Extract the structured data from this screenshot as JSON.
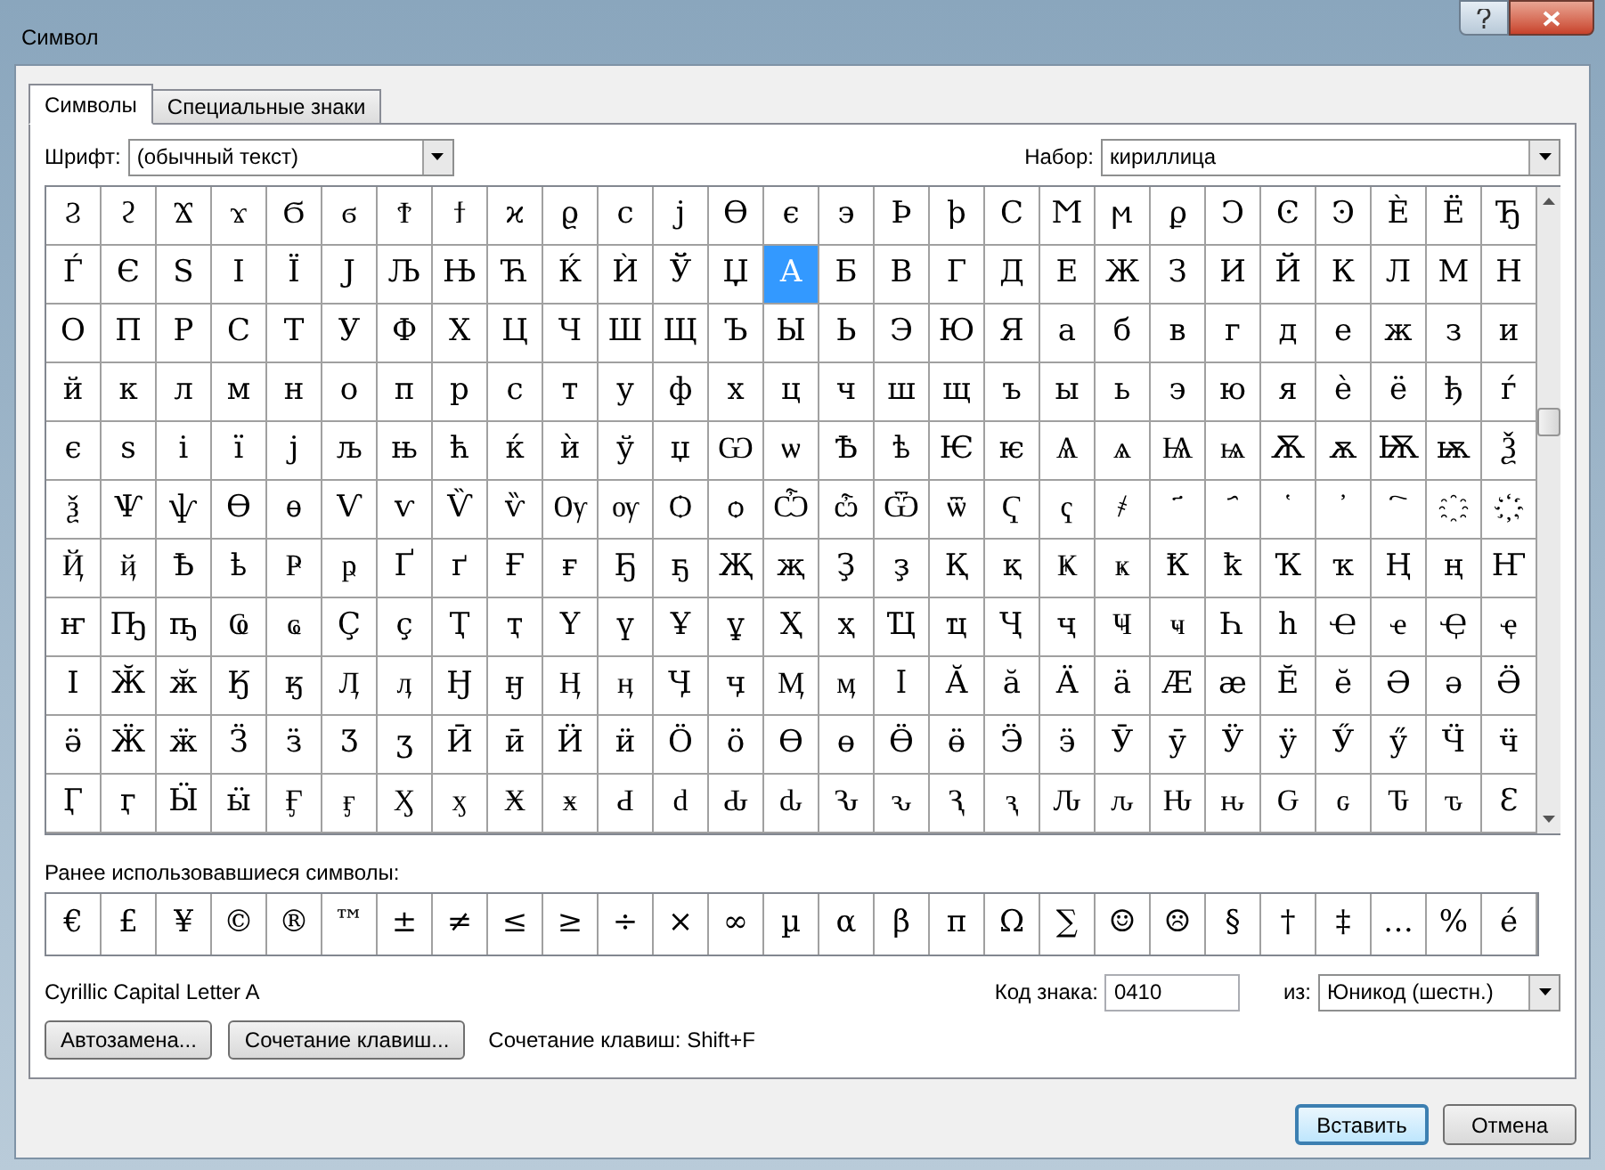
{
  "window": {
    "title": "Символ"
  },
  "tabs": [
    {
      "label": "Символы",
      "selected": true
    },
    {
      "label": "Специальные знаки",
      "selected": false
    }
  ],
  "font": {
    "label": "Шрифт:",
    "value": "(обычный текст)"
  },
  "subset": {
    "label": "Набор:",
    "value": "кириллица"
  },
  "symbol_grid": [
    [
      {
        "ch": "Ϩ",
        "selected": false
      },
      {
        "ch": "ϩ",
        "selected": false
      },
      {
        "ch": "Ϫ",
        "selected": false
      },
      {
        "ch": "ϫ",
        "selected": false
      },
      {
        "ch": "Ϭ",
        "selected": false
      },
      {
        "ch": "ϭ",
        "selected": false
      },
      {
        "ch": "Ϯ",
        "selected": false
      },
      {
        "ch": "ϯ",
        "selected": false
      },
      {
        "ch": "ϰ",
        "selected": false
      },
      {
        "ch": "ϱ",
        "selected": false
      },
      {
        "ch": "ϲ",
        "selected": false
      },
      {
        "ch": "ϳ",
        "selected": false
      },
      {
        "ch": "ϴ",
        "selected": false
      },
      {
        "ch": "ϵ",
        "selected": false
      },
      {
        "ch": "϶",
        "selected": false
      },
      {
        "ch": "Ϸ",
        "selected": false
      },
      {
        "ch": "ϸ",
        "selected": false
      },
      {
        "ch": "Ϲ",
        "selected": false
      },
      {
        "ch": "Ϻ",
        "selected": false
      },
      {
        "ch": "ϻ",
        "selected": false
      },
      {
        "ch": "ϼ",
        "selected": false
      },
      {
        "ch": "Ͻ",
        "selected": false
      },
      {
        "ch": "Ͼ",
        "selected": false
      },
      {
        "ch": "Ͽ",
        "selected": false
      },
      {
        "ch": "Ѐ",
        "selected": false
      },
      {
        "ch": "Ё",
        "selected": false
      },
      {
        "ch": "Ђ",
        "selected": false
      }
    ],
    [
      {
        "ch": "Ѓ",
        "selected": false
      },
      {
        "ch": "Є",
        "selected": false
      },
      {
        "ch": "Ѕ",
        "selected": false
      },
      {
        "ch": "І",
        "selected": false
      },
      {
        "ch": "Ї",
        "selected": false
      },
      {
        "ch": "Ј",
        "selected": false
      },
      {
        "ch": "Љ",
        "selected": false
      },
      {
        "ch": "Њ",
        "selected": false
      },
      {
        "ch": "Ћ",
        "selected": false
      },
      {
        "ch": "Ќ",
        "selected": false
      },
      {
        "ch": "Ѝ",
        "selected": false
      },
      {
        "ch": "Ў",
        "selected": false
      },
      {
        "ch": "Џ",
        "selected": false
      },
      {
        "ch": "А",
        "selected": true
      },
      {
        "ch": "Б",
        "selected": false
      },
      {
        "ch": "В",
        "selected": false
      },
      {
        "ch": "Г",
        "selected": false
      },
      {
        "ch": "Д",
        "selected": false
      },
      {
        "ch": "Е",
        "selected": false
      },
      {
        "ch": "Ж",
        "selected": false
      },
      {
        "ch": "З",
        "selected": false
      },
      {
        "ch": "И",
        "selected": false
      },
      {
        "ch": "Й",
        "selected": false
      },
      {
        "ch": "К",
        "selected": false
      },
      {
        "ch": "Л",
        "selected": false
      },
      {
        "ch": "М",
        "selected": false
      },
      {
        "ch": "Н",
        "selected": false
      }
    ],
    [
      {
        "ch": "О",
        "selected": false
      },
      {
        "ch": "П",
        "selected": false
      },
      {
        "ch": "Р",
        "selected": false
      },
      {
        "ch": "С",
        "selected": false
      },
      {
        "ch": "Т",
        "selected": false
      },
      {
        "ch": "У",
        "selected": false
      },
      {
        "ch": "Ф",
        "selected": false
      },
      {
        "ch": "Х",
        "selected": false
      },
      {
        "ch": "Ц",
        "selected": false
      },
      {
        "ch": "Ч",
        "selected": false
      },
      {
        "ch": "Ш",
        "selected": false
      },
      {
        "ch": "Щ",
        "selected": false
      },
      {
        "ch": "Ъ",
        "selected": false
      },
      {
        "ch": "Ы",
        "selected": false
      },
      {
        "ch": "Ь",
        "selected": false
      },
      {
        "ch": "Э",
        "selected": false
      },
      {
        "ch": "Ю",
        "selected": false
      },
      {
        "ch": "Я",
        "selected": false
      },
      {
        "ch": "а",
        "selected": false
      },
      {
        "ch": "б",
        "selected": false
      },
      {
        "ch": "в",
        "selected": false
      },
      {
        "ch": "г",
        "selected": false
      },
      {
        "ch": "д",
        "selected": false
      },
      {
        "ch": "е",
        "selected": false
      },
      {
        "ch": "ж",
        "selected": false
      },
      {
        "ch": "з",
        "selected": false
      },
      {
        "ch": "и",
        "selected": false
      }
    ],
    [
      {
        "ch": "й",
        "selected": false
      },
      {
        "ch": "к",
        "selected": false
      },
      {
        "ch": "л",
        "selected": false
      },
      {
        "ch": "м",
        "selected": false
      },
      {
        "ch": "н",
        "selected": false
      },
      {
        "ch": "о",
        "selected": false
      },
      {
        "ch": "п",
        "selected": false
      },
      {
        "ch": "р",
        "selected": false
      },
      {
        "ch": "с",
        "selected": false
      },
      {
        "ch": "т",
        "selected": false
      },
      {
        "ch": "у",
        "selected": false
      },
      {
        "ch": "ф",
        "selected": false
      },
      {
        "ch": "х",
        "selected": false
      },
      {
        "ch": "ц",
        "selected": false
      },
      {
        "ch": "ч",
        "selected": false
      },
      {
        "ch": "ш",
        "selected": false
      },
      {
        "ch": "щ",
        "selected": false
      },
      {
        "ch": "ъ",
        "selected": false
      },
      {
        "ch": "ы",
        "selected": false
      },
      {
        "ch": "ь",
        "selected": false
      },
      {
        "ch": "э",
        "selected": false
      },
      {
        "ch": "ю",
        "selected": false
      },
      {
        "ch": "я",
        "selected": false
      },
      {
        "ch": "ѐ",
        "selected": false
      },
      {
        "ch": "ё",
        "selected": false
      },
      {
        "ch": "ђ",
        "selected": false
      },
      {
        "ch": "ѓ",
        "selected": false
      }
    ],
    [
      {
        "ch": "є",
        "selected": false
      },
      {
        "ch": "ѕ",
        "selected": false
      },
      {
        "ch": "і",
        "selected": false
      },
      {
        "ch": "ї",
        "selected": false
      },
      {
        "ch": "ј",
        "selected": false
      },
      {
        "ch": "љ",
        "selected": false
      },
      {
        "ch": "њ",
        "selected": false
      },
      {
        "ch": "ћ",
        "selected": false
      },
      {
        "ch": "ќ",
        "selected": false
      },
      {
        "ch": "ѝ",
        "selected": false
      },
      {
        "ch": "ў",
        "selected": false
      },
      {
        "ch": "џ",
        "selected": false
      },
      {
        "ch": "Ѡ",
        "selected": false
      },
      {
        "ch": "ѡ",
        "selected": false
      },
      {
        "ch": "Ѣ",
        "selected": false
      },
      {
        "ch": "ѣ",
        "selected": false
      },
      {
        "ch": "Ѥ",
        "selected": false
      },
      {
        "ch": "ѥ",
        "selected": false
      },
      {
        "ch": "Ѧ",
        "selected": false
      },
      {
        "ch": "ѧ",
        "selected": false
      },
      {
        "ch": "Ѩ",
        "selected": false
      },
      {
        "ch": "ѩ",
        "selected": false
      },
      {
        "ch": "Ѫ",
        "selected": false
      },
      {
        "ch": "ѫ",
        "selected": false
      },
      {
        "ch": "Ѭ",
        "selected": false
      },
      {
        "ch": "ѭ",
        "selected": false
      },
      {
        "ch": "Ѯ",
        "selected": false
      }
    ],
    [
      {
        "ch": "ѯ",
        "selected": false
      },
      {
        "ch": "Ѱ",
        "selected": false
      },
      {
        "ch": "ѱ",
        "selected": false
      },
      {
        "ch": "Ѳ",
        "selected": false
      },
      {
        "ch": "ѳ",
        "selected": false
      },
      {
        "ch": "Ѵ",
        "selected": false
      },
      {
        "ch": "ѵ",
        "selected": false
      },
      {
        "ch": "Ѷ",
        "selected": false
      },
      {
        "ch": "ѷ",
        "selected": false
      },
      {
        "ch": "Ѹ",
        "selected": false
      },
      {
        "ch": "ѹ",
        "selected": false
      },
      {
        "ch": "Ѻ",
        "selected": false
      },
      {
        "ch": "ѻ",
        "selected": false
      },
      {
        "ch": "Ѽ",
        "selected": false
      },
      {
        "ch": "ѽ",
        "selected": false
      },
      {
        "ch": "Ѿ",
        "selected": false
      },
      {
        "ch": "ѿ",
        "selected": false
      },
      {
        "ch": "Ҁ",
        "selected": false
      },
      {
        "ch": "ҁ",
        "selected": false
      },
      {
        "ch": "҂",
        "selected": false
      },
      {
        "ch": "҃",
        "selected": false
      },
      {
        "ch": "҄",
        "selected": false
      },
      {
        "ch": "҅",
        "selected": false
      },
      {
        "ch": "҆",
        "selected": false
      },
      {
        "ch": "҇",
        "selected": false
      },
      {
        "ch": "҈",
        "selected": false
      },
      {
        "ch": "҉",
        "selected": false
      }
    ],
    [
      {
        "ch": "Ҋ",
        "selected": false
      },
      {
        "ch": "ҋ",
        "selected": false
      },
      {
        "ch": "Ҍ",
        "selected": false
      },
      {
        "ch": "ҍ",
        "selected": false
      },
      {
        "ch": "Ҏ",
        "selected": false
      },
      {
        "ch": "ҏ",
        "selected": false
      },
      {
        "ch": "Ґ",
        "selected": false
      },
      {
        "ch": "ґ",
        "selected": false
      },
      {
        "ch": "Ғ",
        "selected": false
      },
      {
        "ch": "ғ",
        "selected": false
      },
      {
        "ch": "Ҕ",
        "selected": false
      },
      {
        "ch": "ҕ",
        "selected": false
      },
      {
        "ch": "Җ",
        "selected": false
      },
      {
        "ch": "җ",
        "selected": false
      },
      {
        "ch": "Ҙ",
        "selected": false
      },
      {
        "ch": "ҙ",
        "selected": false
      },
      {
        "ch": "Қ",
        "selected": false
      },
      {
        "ch": "қ",
        "selected": false
      },
      {
        "ch": "Ҝ",
        "selected": false
      },
      {
        "ch": "ҝ",
        "selected": false
      },
      {
        "ch": "Ҟ",
        "selected": false
      },
      {
        "ch": "ҟ",
        "selected": false
      },
      {
        "ch": "Ҡ",
        "selected": false
      },
      {
        "ch": "ҡ",
        "selected": false
      },
      {
        "ch": "Ң",
        "selected": false
      },
      {
        "ch": "ң",
        "selected": false
      },
      {
        "ch": "Ҥ",
        "selected": false
      }
    ],
    [
      {
        "ch": "ҥ",
        "selected": false
      },
      {
        "ch": "Ҧ",
        "selected": false
      },
      {
        "ch": "ҧ",
        "selected": false
      },
      {
        "ch": "Ҩ",
        "selected": false
      },
      {
        "ch": "ҩ",
        "selected": false
      },
      {
        "ch": "Ҫ",
        "selected": false
      },
      {
        "ch": "ҫ",
        "selected": false
      },
      {
        "ch": "Ҭ",
        "selected": false
      },
      {
        "ch": "ҭ",
        "selected": false
      },
      {
        "ch": "Ү",
        "selected": false
      },
      {
        "ch": "ү",
        "selected": false
      },
      {
        "ch": "Ұ",
        "selected": false
      },
      {
        "ch": "ұ",
        "selected": false
      },
      {
        "ch": "Ҳ",
        "selected": false
      },
      {
        "ch": "ҳ",
        "selected": false
      },
      {
        "ch": "Ҵ",
        "selected": false
      },
      {
        "ch": "ҵ",
        "selected": false
      },
      {
        "ch": "Ҷ",
        "selected": false
      },
      {
        "ch": "ҷ",
        "selected": false
      },
      {
        "ch": "Ҹ",
        "selected": false
      },
      {
        "ch": "ҹ",
        "selected": false
      },
      {
        "ch": "Һ",
        "selected": false
      },
      {
        "ch": "һ",
        "selected": false
      },
      {
        "ch": "Ҽ",
        "selected": false
      },
      {
        "ch": "ҽ",
        "selected": false
      },
      {
        "ch": "Ҿ",
        "selected": false
      },
      {
        "ch": "ҿ",
        "selected": false
      }
    ],
    [
      {
        "ch": "Ӏ",
        "selected": false
      },
      {
        "ch": "Ӂ",
        "selected": false
      },
      {
        "ch": "ӂ",
        "selected": false
      },
      {
        "ch": "Ӄ",
        "selected": false
      },
      {
        "ch": "ӄ",
        "selected": false
      },
      {
        "ch": "Ӆ",
        "selected": false
      },
      {
        "ch": "ӆ",
        "selected": false
      },
      {
        "ch": "Ӈ",
        "selected": false
      },
      {
        "ch": "ӈ",
        "selected": false
      },
      {
        "ch": "Ӊ",
        "selected": false
      },
      {
        "ch": "ӊ",
        "selected": false
      },
      {
        "ch": "Ӌ",
        "selected": false
      },
      {
        "ch": "ӌ",
        "selected": false
      },
      {
        "ch": "Ӎ",
        "selected": false
      },
      {
        "ch": "ӎ",
        "selected": false
      },
      {
        "ch": "ӏ",
        "selected": false
      },
      {
        "ch": "Ӑ",
        "selected": false
      },
      {
        "ch": "ӑ",
        "selected": false
      },
      {
        "ch": "Ӓ",
        "selected": false
      },
      {
        "ch": "ӓ",
        "selected": false
      },
      {
        "ch": "Ӕ",
        "selected": false
      },
      {
        "ch": "ӕ",
        "selected": false
      },
      {
        "ch": "Ӗ",
        "selected": false
      },
      {
        "ch": "ӗ",
        "selected": false
      },
      {
        "ch": "Ә",
        "selected": false
      },
      {
        "ch": "ә",
        "selected": false
      },
      {
        "ch": "Ӛ",
        "selected": false
      }
    ],
    [
      {
        "ch": "ӛ",
        "selected": false
      },
      {
        "ch": "Ӝ",
        "selected": false
      },
      {
        "ch": "ӝ",
        "selected": false
      },
      {
        "ch": "Ӟ",
        "selected": false
      },
      {
        "ch": "ӟ",
        "selected": false
      },
      {
        "ch": "Ӡ",
        "selected": false
      },
      {
        "ch": "ӡ",
        "selected": false
      },
      {
        "ch": "Ӣ",
        "selected": false
      },
      {
        "ch": "ӣ",
        "selected": false
      },
      {
        "ch": "Ӥ",
        "selected": false
      },
      {
        "ch": "ӥ",
        "selected": false
      },
      {
        "ch": "Ӧ",
        "selected": false
      },
      {
        "ch": "ӧ",
        "selected": false
      },
      {
        "ch": "Ө",
        "selected": false
      },
      {
        "ch": "ө",
        "selected": false
      },
      {
        "ch": "Ӫ",
        "selected": false
      },
      {
        "ch": "ӫ",
        "selected": false
      },
      {
        "ch": "Ӭ",
        "selected": false
      },
      {
        "ch": "ӭ",
        "selected": false
      },
      {
        "ch": "Ӯ",
        "selected": false
      },
      {
        "ch": "ӯ",
        "selected": false
      },
      {
        "ch": "Ӱ",
        "selected": false
      },
      {
        "ch": "ӱ",
        "selected": false
      },
      {
        "ch": "Ӳ",
        "selected": false
      },
      {
        "ch": "ӳ",
        "selected": false
      },
      {
        "ch": "Ӵ",
        "selected": false
      },
      {
        "ch": "ӵ",
        "selected": false
      }
    ],
    [
      {
        "ch": "Ӷ",
        "selected": false
      },
      {
        "ch": "ӷ",
        "selected": false
      },
      {
        "ch": "Ӹ",
        "selected": false
      },
      {
        "ch": "ӹ",
        "selected": false
      },
      {
        "ch": "Ӻ",
        "selected": false
      },
      {
        "ch": "ӻ",
        "selected": false
      },
      {
        "ch": "Ӽ",
        "selected": false
      },
      {
        "ch": "ӽ",
        "selected": false
      },
      {
        "ch": "Ӿ",
        "selected": false
      },
      {
        "ch": "ӿ",
        "selected": false
      },
      {
        "ch": "Ԁ",
        "selected": false
      },
      {
        "ch": "ԁ",
        "selected": false
      },
      {
        "ch": "Ԃ",
        "selected": false
      },
      {
        "ch": "ԃ",
        "selected": false
      },
      {
        "ch": "Ԅ",
        "selected": false
      },
      {
        "ch": "ԅ",
        "selected": false
      },
      {
        "ch": "Ԇ",
        "selected": false
      },
      {
        "ch": "ԇ",
        "selected": false
      },
      {
        "ch": "Ԉ",
        "selected": false
      },
      {
        "ch": "ԉ",
        "selected": false
      },
      {
        "ch": "Ԋ",
        "selected": false
      },
      {
        "ch": "ԋ",
        "selected": false
      },
      {
        "ch": "Ԍ",
        "selected": false
      },
      {
        "ch": "ԍ",
        "selected": false
      },
      {
        "ch": "Ԏ",
        "selected": false
      },
      {
        "ch": "ԏ",
        "selected": false
      },
      {
        "ch": "Ԑ",
        "selected": false
      }
    ]
  ],
  "recent_symbols": {
    "label": "Ранее использовавшиеся символы:",
    "items": [
      "€",
      "£",
      "¥",
      "©",
      "®",
      "™",
      "±",
      "≠",
      "≤",
      "≥",
      "÷",
      "×",
      "∞",
      "µ",
      "α",
      "β",
      "π",
      "Ω",
      "∑",
      "☺",
      "☹",
      "§",
      "†",
      "‡",
      "…",
      "%",
      "é"
    ]
  },
  "character_name": "Cyrillic Capital Letter A",
  "char_code": {
    "label": "Код знака:",
    "value": "0410"
  },
  "from": {
    "label": "из:",
    "value": "Юникод (шестн.)"
  },
  "buttons": [
    {
      "label": "Автозамена..."
    },
    {
      "label": "Сочетание клавиш..."
    }
  ],
  "shortcut_text": "Сочетание клавиш: Shift+F",
  "footer_buttons": [
    {
      "label": "Вставить",
      "default": true
    },
    {
      "label": "Отмена",
      "default": false
    }
  ]
}
